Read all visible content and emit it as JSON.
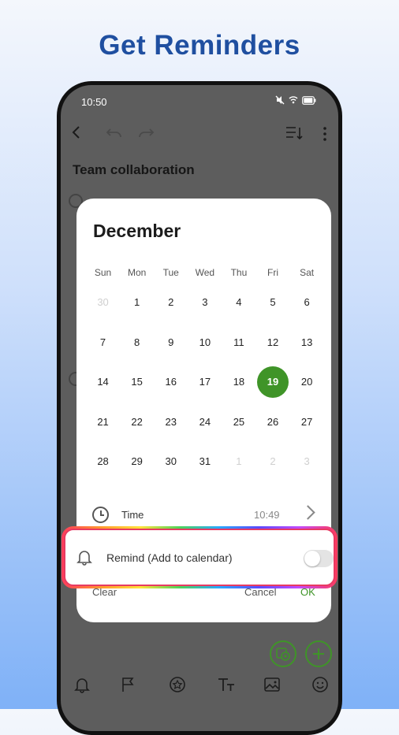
{
  "headline": "Get Reminders",
  "status": {
    "time": "10:50"
  },
  "note": {
    "title": "Team collaboration"
  },
  "dialog": {
    "month": "December",
    "weekdays": [
      "Sun",
      "Mon",
      "Tue",
      "Wed",
      "Thu",
      "Fri",
      "Sat"
    ],
    "weeks": [
      [
        "30",
        "1",
        "2",
        "3",
        "4",
        "5",
        "6"
      ],
      [
        "7",
        "8",
        "9",
        "10",
        "11",
        "12",
        "13"
      ],
      [
        "14",
        "15",
        "16",
        "17",
        "18",
        "19",
        "20"
      ],
      [
        "21",
        "22",
        "23",
        "24",
        "25",
        "26",
        "27"
      ],
      [
        "28",
        "29",
        "30",
        "31",
        "1",
        "2",
        "3"
      ]
    ],
    "selected_day": "19",
    "time_label": "Time",
    "time_value": "10:49",
    "remind_label": "Remind (Add to calendar)",
    "remind_enabled": false,
    "clear_label": "Clear",
    "cancel_label": "Cancel",
    "ok_label": "OK"
  },
  "colors": {
    "accent": "#3f9428",
    "headline": "#1f4fa0",
    "highlight_border": "#e83a62"
  }
}
